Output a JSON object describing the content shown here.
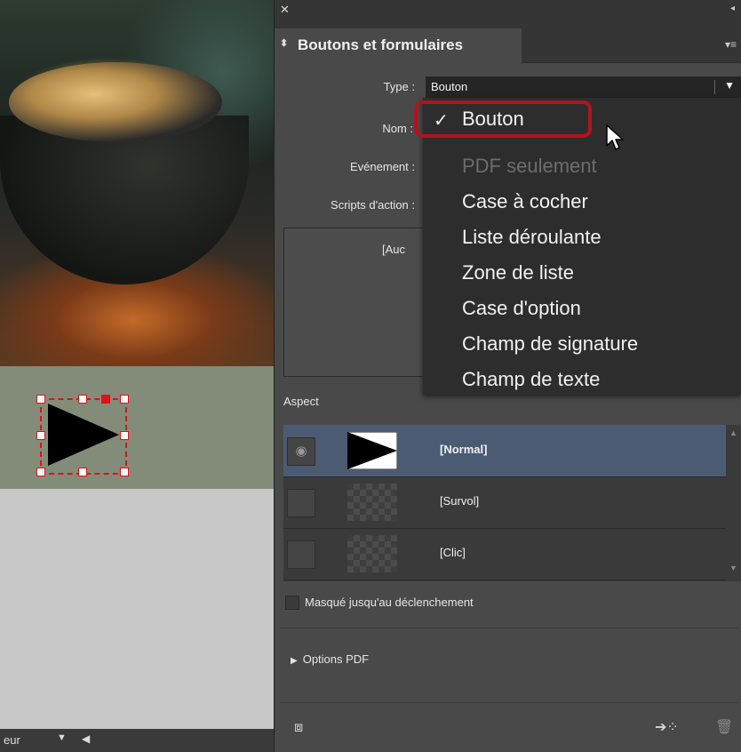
{
  "document": {
    "bottom_bar": {
      "label": "eur",
      "dropdown_icon": "triangle-down",
      "back_icon": "triangle-left"
    }
  },
  "panel": {
    "title": "Boutons et formulaires",
    "fields": {
      "type_label": "Type :",
      "type_value": "Bouton",
      "name_label": "Nom :",
      "event_label": "Evénement :",
      "actions_label": "Scripts d'action :",
      "actions_placeholder": "[Auc"
    },
    "aspect": {
      "label": "Aspect",
      "states": [
        {
          "label": "[Normal]",
          "selected": true
        },
        {
          "label": "[Survol]",
          "selected": false
        },
        {
          "label": "[Clic]",
          "selected": false
        }
      ]
    },
    "hidden_until_triggered": {
      "label": "Masqué jusqu'au déclenchement",
      "checked": false
    },
    "pdf_options": {
      "label": "Options PDF"
    }
  },
  "type_menu": {
    "items": [
      {
        "label": "Bouton",
        "checked": true,
        "disabled": false
      },
      {
        "label": "PDF seulement",
        "checked": false,
        "disabled": true
      },
      {
        "label": "Case à cocher",
        "checked": false,
        "disabled": false
      },
      {
        "label": "Liste déroulante",
        "checked": false,
        "disabled": false
      },
      {
        "label": "Zone de liste",
        "checked": false,
        "disabled": false
      },
      {
        "label": "Case d'option",
        "checked": false,
        "disabled": false
      },
      {
        "label": "Champ de signature",
        "checked": false,
        "disabled": false
      },
      {
        "label": "Champ de texte",
        "checked": false,
        "disabled": false
      }
    ]
  },
  "colors": {
    "panel_bg": "#494949",
    "menu_bg": "#2d2d2d",
    "selection_red": "#e0101a",
    "highlight_red": "#b1141c",
    "selected_row": "#4b5b73"
  }
}
